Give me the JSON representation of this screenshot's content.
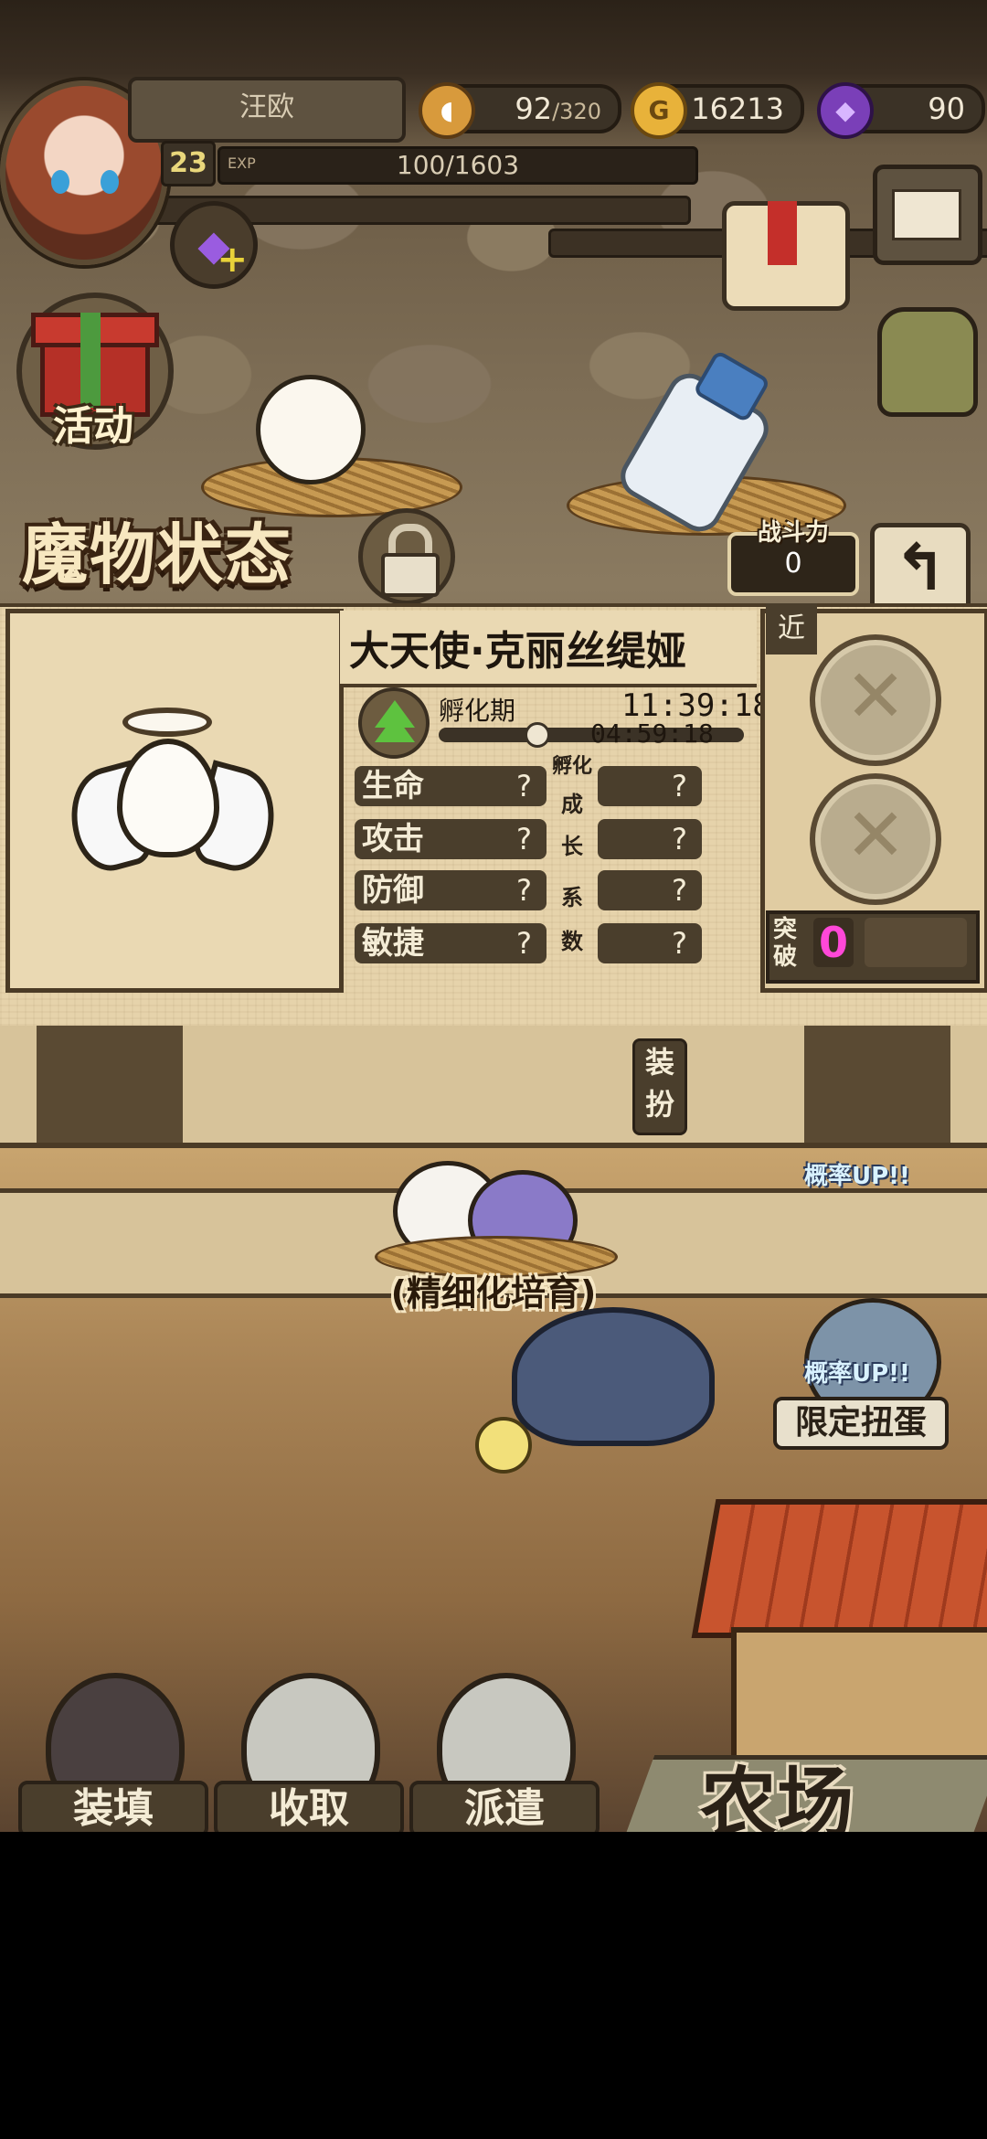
{
  "player": {
    "name": "汪欧",
    "level": "23",
    "exp_label": "EXP",
    "exp_value": "100/1603"
  },
  "resources": {
    "stamina_current": "92",
    "stamina_max": "/320",
    "gold": "16213",
    "gems": "90",
    "gold_icon": "G"
  },
  "side": {
    "activity_label": "活动"
  },
  "panel": {
    "title": "魔物状态",
    "power_label": "战斗力",
    "power_value": "0",
    "back_symbol": "↰",
    "monster_name": "大天使·克丽丝缇娅",
    "stage_label": "孵化期",
    "timer_total": "11:39:18",
    "timer_remaining": "04:59:18",
    "hatch_progress": 0.3,
    "growth_label_top": "孵化",
    "growth_label_chars": [
      "成",
      "长",
      "系",
      "数"
    ],
    "stats": [
      {
        "label": "生命",
        "value": "?",
        "growth": "?"
      },
      {
        "label": "攻击",
        "value": "?",
        "growth": "?"
      },
      {
        "label": "防御",
        "value": "?",
        "growth": "?"
      },
      {
        "label": "敏捷",
        "value": "?",
        "growth": "?"
      }
    ],
    "near_tab": "近",
    "break_label": "突破",
    "break_value": "0",
    "equip_label": "装扮"
  },
  "farm": {
    "fine_breed": "(精细化培育)",
    "rate_up_1": "概率UP!!",
    "rate_up_2": "概率UP!!",
    "limited_gacha": "限定扭蛋",
    "farm_label": "农场"
  },
  "bottom_nav": {
    "load": "装填",
    "collect": "收取",
    "dispatch": "派遣"
  },
  "colors": {
    "accent_pink": "#ff48d8",
    "parchment": "#e6d3ab",
    "frame": "#4b3b26"
  }
}
